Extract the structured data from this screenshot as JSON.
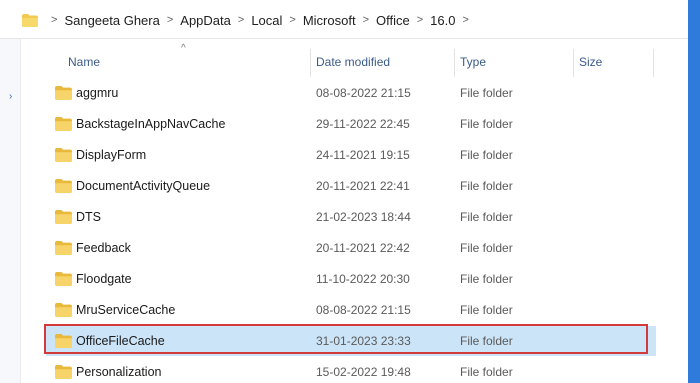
{
  "breadcrumb": {
    "items": [
      "Sangeeta Ghera",
      "AppData",
      "Local",
      "Microsoft",
      "Office",
      "16.0"
    ],
    "separator": ">"
  },
  "columns": {
    "name": "Name",
    "date": "Date modified",
    "type": "Type",
    "size": "Size"
  },
  "files": [
    {
      "name": "aggmru",
      "date": "08-08-2022 21:15",
      "type": "File folder",
      "selected": false
    },
    {
      "name": "BackstageInAppNavCache",
      "date": "29-11-2022 22:45",
      "type": "File folder",
      "selected": false
    },
    {
      "name": "DisplayForm",
      "date": "24-11-2021 19:15",
      "type": "File folder",
      "selected": false
    },
    {
      "name": "DocumentActivityQueue",
      "date": "20-11-2021 22:41",
      "type": "File folder",
      "selected": false
    },
    {
      "name": "DTS",
      "date": "21-02-2023 18:44",
      "type": "File folder",
      "selected": false
    },
    {
      "name": "Feedback",
      "date": "20-11-2021 22:42",
      "type": "File folder",
      "selected": false
    },
    {
      "name": "Floodgate",
      "date": "11-10-2022 20:30",
      "type": "File folder",
      "selected": false
    },
    {
      "name": "MruServiceCache",
      "date": "08-08-2022 21:15",
      "type": "File folder",
      "selected": false
    },
    {
      "name": "OfficeFileCache",
      "date": "31-01-2023 23:33",
      "type": "File folder",
      "selected": true
    },
    {
      "name": "Personalization",
      "date": "15-02-2022 19:48",
      "type": "File folder",
      "selected": false
    }
  ],
  "icons": {
    "folder": "folder-icon",
    "chevron": "chevron-right-icon",
    "sort": "sort-ascending-icon"
  },
  "colors": {
    "selection": "#cce4f7",
    "highlight": "#d33b3b",
    "folder": "#f3c94f",
    "background": "#2f7bdc"
  }
}
